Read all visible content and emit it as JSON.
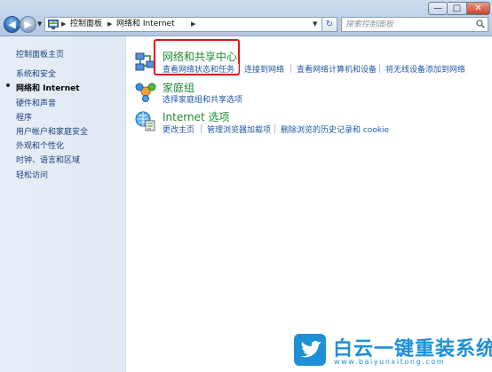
{
  "window": {
    "minimize_glyph": "—",
    "maximize_glyph": "□",
    "close_glyph": "✕"
  },
  "nav": {
    "back_glyph": "◀",
    "forward_glyph": "▶",
    "dropdown_glyph": "▼",
    "refresh_glyph": "↻"
  },
  "address": {
    "crumbs": [
      "控制面板",
      "网络和 Internet"
    ],
    "separator": "▶"
  },
  "search": {
    "placeholder": "搜索控制面板"
  },
  "sidebar": {
    "items": [
      {
        "label": "控制面板主页"
      },
      {
        "label": "系统和安全"
      },
      {
        "label": "网络和 Internet",
        "active": true
      },
      {
        "label": "硬件和声音"
      },
      {
        "label": "程序"
      },
      {
        "label": "用户帐户和家庭安全"
      },
      {
        "label": "外观和个性化"
      },
      {
        "label": "时钟、语言和区域"
      },
      {
        "label": "轻松访问"
      }
    ]
  },
  "categories": [
    {
      "title": "网络和共享中心",
      "icon": "network-sharing-icon",
      "tasks": [
        "查看网络状态和任务",
        "连接到网络",
        "查看网络计算机和设备",
        "将无线设备添加到网络"
      ]
    },
    {
      "title": "家庭组",
      "icon": "homegroup-icon",
      "tasks": [
        "选择家庭组和共享选项"
      ]
    },
    {
      "title": "Internet 选项",
      "icon": "internet-options-icon",
      "tasks": [
        "更改主页",
        "管理浏览器加载项",
        "删除浏览的历史记录和 cookie"
      ]
    }
  ],
  "watermark": {
    "text": "白云一键重装系统",
    "url": "www.baiyunxitong.com",
    "icon": "twitter-bird-icon"
  },
  "colors": {
    "link": "#1f57a8",
    "category": "#1f8a2f",
    "highlight": "#e0131b",
    "watermark": "#1e8fd8"
  }
}
